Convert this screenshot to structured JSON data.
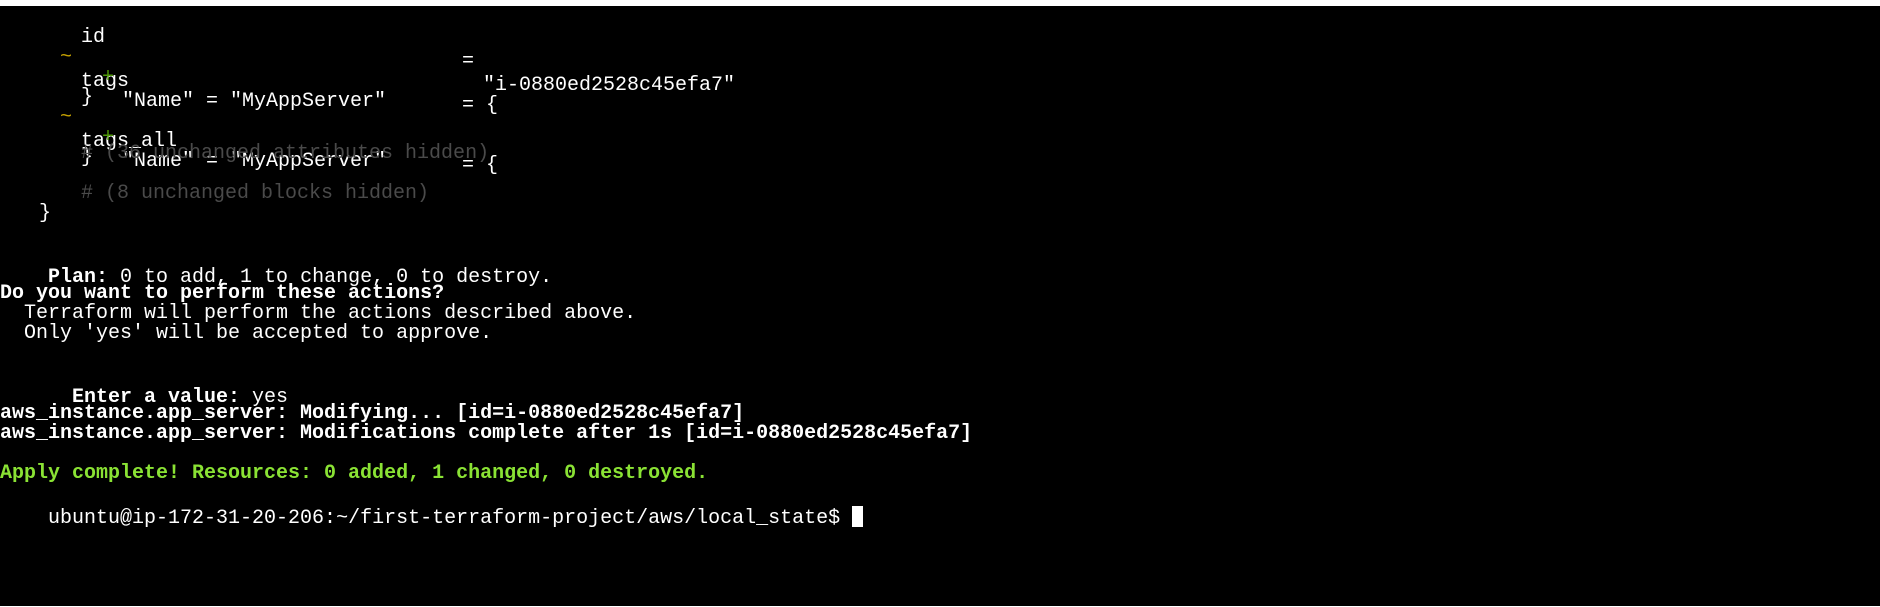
{
  "terminal": {
    "diff": {
      "id_key": "id",
      "id_eq": "=",
      "id_value": "\"i-0880ed2528c45efa7\"",
      "tags_marker": "~",
      "tags_key": "tags",
      "tags_eq": "= {",
      "tags_add_marker": "+",
      "tags_add_value": "\"Name\" = \"MyAppServer\"",
      "tags_close": "}",
      "tags_all_marker": "~",
      "tags_all_key": "tags_all",
      "tags_all_eq": "= {",
      "tags_all_add_marker": "+",
      "tags_all_add_value": "\"Name\" = \"MyAppServer\"",
      "tags_all_close": "}",
      "hidden_attrs": "# (36 unchanged attributes hidden)",
      "hidden_blocks": "# (8 unchanged blocks hidden)",
      "resource_close": "}"
    },
    "plan": {
      "label": "Plan:",
      "text": " 0 to add, 1 to change, 0 to destroy."
    },
    "prompt_question": {
      "title": "Do you want to perform these actions?",
      "line1": "  Terraform will perform the actions described above.",
      "line2": "  Only 'yes' will be accepted to approve."
    },
    "enter_value": {
      "label": "  Enter a value:",
      "value": " yes"
    },
    "modifying": "aws_instance.app_server: Modifying... [id=i-0880ed2528c45efa7]",
    "modified": "aws_instance.app_server: Modifications complete after 1s [id=i-0880ed2528c45efa7]",
    "apply_complete": "Apply complete! Resources: 0 added, 1 changed, 0 destroyed.",
    "shell_prompt": "ubuntu@ip-172-31-20-206:~/first-terraform-project/aws/local_state$ "
  },
  "colors": {
    "background": "#000000",
    "foreground": "#ffffff",
    "tilde": "#c4a000",
    "plus": "#4e9a06",
    "muted": "#4a4a4a",
    "success": "#8ae234"
  }
}
